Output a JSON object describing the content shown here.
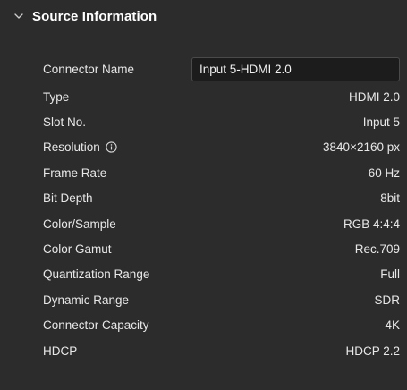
{
  "section": {
    "title": "Source Information",
    "expanded": true
  },
  "connector_name": {
    "label": "Connector Name",
    "value": "Input 5-HDMI 2.0"
  },
  "fields": [
    {
      "key": "type",
      "label": "Type",
      "value": "HDMI 2.0"
    },
    {
      "key": "slot-no",
      "label": "Slot No.",
      "value": "Input 5"
    },
    {
      "key": "resolution",
      "label": "Resolution",
      "value": "3840×2160 px",
      "has_info_icon": true
    },
    {
      "key": "frame-rate",
      "label": "Frame Rate",
      "value": "60 Hz"
    },
    {
      "key": "bit-depth",
      "label": "Bit Depth",
      "value": "8bit"
    },
    {
      "key": "color-sample",
      "label": "Color/Sample",
      "value": "RGB 4:4:4"
    },
    {
      "key": "color-gamut",
      "label": "Color Gamut",
      "value": "Rec.709"
    },
    {
      "key": "quantization-range",
      "label": "Quantization Range",
      "value": "Full"
    },
    {
      "key": "dynamic-range",
      "label": "Dynamic Range",
      "value": "SDR"
    },
    {
      "key": "connector-capacity",
      "label": "Connector Capacity",
      "value": "4K"
    },
    {
      "key": "hdcp",
      "label": "HDCP",
      "value": "HDCP 2.2"
    }
  ],
  "icons": {
    "collapse": "chevron-down-icon",
    "info": "info-icon"
  },
  "colors": {
    "background": "#2c2c2c",
    "input_background": "#1c1c1c",
    "text": "#e8e8e8"
  }
}
